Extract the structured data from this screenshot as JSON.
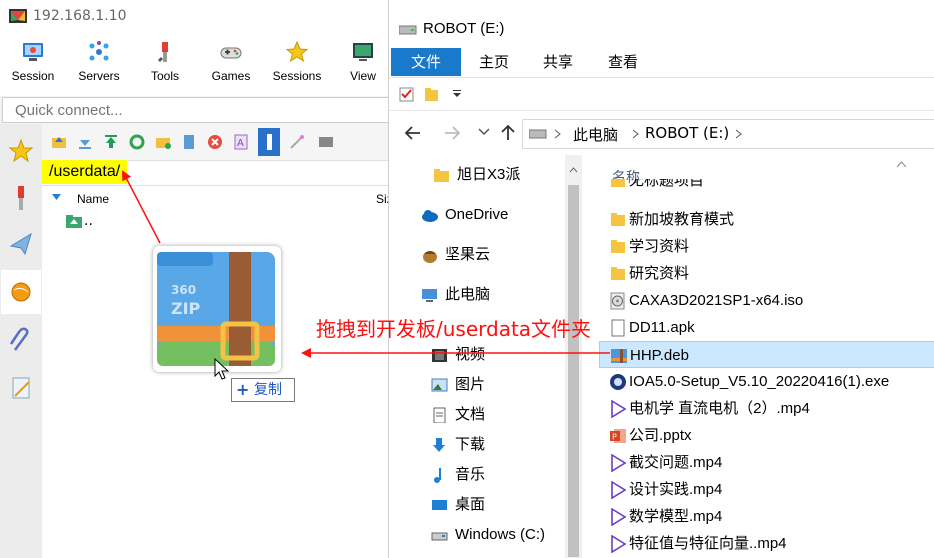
{
  "moba": {
    "title": "192.168.1.10",
    "toolbar": [
      "Session",
      "Servers",
      "Tools",
      "Games",
      "Sessions",
      "View"
    ],
    "quick_connect_placeholder": "Quick connect...",
    "path": "/userdata/",
    "columns": {
      "name": "Name",
      "size": "Siz"
    },
    "rows": [
      ".."
    ]
  },
  "explorer": {
    "title": "ROBOT (E:)",
    "ribbon_tabs": [
      "文件",
      "主页",
      "共享",
      "查看"
    ],
    "breadcrumb": [
      "此电脑",
      "ROBOT (E:)"
    ],
    "column_name": "名称",
    "nav": [
      {
        "label": "旭日X3派",
        "icon": "folder-icon"
      },
      {
        "label": "OneDrive",
        "icon": "cloud-icon"
      },
      {
        "label": "坚果云",
        "icon": "nut-icon"
      },
      {
        "label": "此电脑",
        "icon": "computer-icon"
      },
      {
        "label": "视频",
        "icon": "video-icon"
      },
      {
        "label": "图片",
        "icon": "picture-icon"
      },
      {
        "label": "文档",
        "icon": "document-icon"
      },
      {
        "label": "下载",
        "icon": "download-icon"
      },
      {
        "label": "音乐",
        "icon": "music-icon"
      },
      {
        "label": "桌面",
        "icon": "desktop-icon"
      },
      {
        "label": "Windows (C:)",
        "icon": "drive-icon"
      }
    ],
    "files": [
      {
        "name": "无标题项目",
        "icon": "folder-icon"
      },
      {
        "name": "新加坡教育模式",
        "icon": "folder-icon"
      },
      {
        "name": "学习资料",
        "icon": "folder-icon"
      },
      {
        "name": "研究资料",
        "icon": "folder-icon"
      },
      {
        "name": "CAXA3D2021SP1-x64.iso",
        "icon": "disc-image-icon"
      },
      {
        "name": "DD11.apk",
        "icon": "file-icon"
      },
      {
        "name": "HHP.deb",
        "icon": "archive-icon",
        "selected": true
      },
      {
        "name": "IOA5.0-Setup_V5.10_20220416(1).exe",
        "icon": "setup-icon"
      },
      {
        "name": "电机学 直流电机（2）.mp4",
        "icon": "video-file-icon"
      },
      {
        "name": "公司.pptx",
        "icon": "powerpoint-icon"
      },
      {
        "name": "截交问题.mp4",
        "icon": "video-file-icon"
      },
      {
        "name": "设计实践.mp4",
        "icon": "video-file-icon"
      },
      {
        "name": "数学模型.mp4",
        "icon": "video-file-icon"
      },
      {
        "name": "特征值与特征向量..mp4",
        "icon": "video-file-icon"
      }
    ]
  },
  "overlay": {
    "annotation": "拖拽到开发板/userdata文件夹",
    "copy_badge": "复制",
    "copy_symbol": "+",
    "zip_brand": "360",
    "zip_text": "ZIP"
  },
  "colors": {
    "accent": "#1979ca",
    "annotation": "#ff1010",
    "path_highlight": "#ffff00",
    "selection": "#cce8ff"
  }
}
